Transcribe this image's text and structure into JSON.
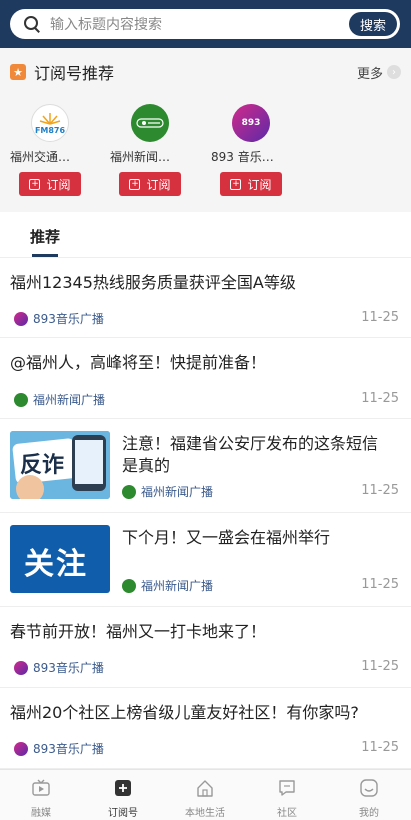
{
  "search": {
    "placeholder": "输入标题内容搜索",
    "button_label": "搜索"
  },
  "subscriptions": {
    "section_title": "订阅号推荐",
    "more_label": "更多",
    "channels": [
      {
        "name": "福州交通…",
        "logo_text": "FM876",
        "subscribe_label": "订阅"
      },
      {
        "name": "福州新闻…",
        "logo_text": "",
        "subscribe_label": "订阅"
      },
      {
        "name": "893 音乐…",
        "logo_text": "893",
        "subscribe_label": "订阅"
      }
    ]
  },
  "tabs": {
    "active_label": "推荐"
  },
  "feed": [
    {
      "title": "福州12345热线服务质量获评全国A等级",
      "source": "893音乐广播",
      "date": "11-25",
      "icon": "music-893-icon"
    },
    {
      "title": "@福州人，高峰将至！快提前准备！",
      "source": "福州新闻广播",
      "date": "11-25",
      "icon": "news-radio-icon"
    },
    {
      "title": "注意！福建省公安厅发布的这条短信是真的",
      "source": "福州新闻广播",
      "date": "11-25",
      "thumb_text": "反诈",
      "icon": "news-radio-icon"
    },
    {
      "title": "下个月！又一盛会在福州举行",
      "source": "福州新闻广播",
      "date": "11-25",
      "thumb_text": "关注",
      "icon": "news-radio-icon"
    },
    {
      "title": "春节前开放！福州又一打卡地来了！",
      "source": "893音乐广播",
      "date": "11-25",
      "icon": "music-893-icon"
    },
    {
      "title": "福州20个社区上榜省级儿童友好社区！有你家吗?",
      "source": "893音乐广播",
      "date": "11-25",
      "icon": "music-893-icon"
    }
  ],
  "bottom_nav": [
    {
      "label": "融媒",
      "icon": "tv-icon"
    },
    {
      "label": "订阅号",
      "icon": "plus-square-icon"
    },
    {
      "label": "本地生活",
      "icon": "home-icon"
    },
    {
      "label": "社区",
      "icon": "chat-icon"
    },
    {
      "label": "我的",
      "icon": "smile-icon"
    }
  ],
  "colors": {
    "header_bg": "#1e3a5f",
    "subscribe_red": "#d6313f",
    "source_blue": "#3a5a8c"
  }
}
